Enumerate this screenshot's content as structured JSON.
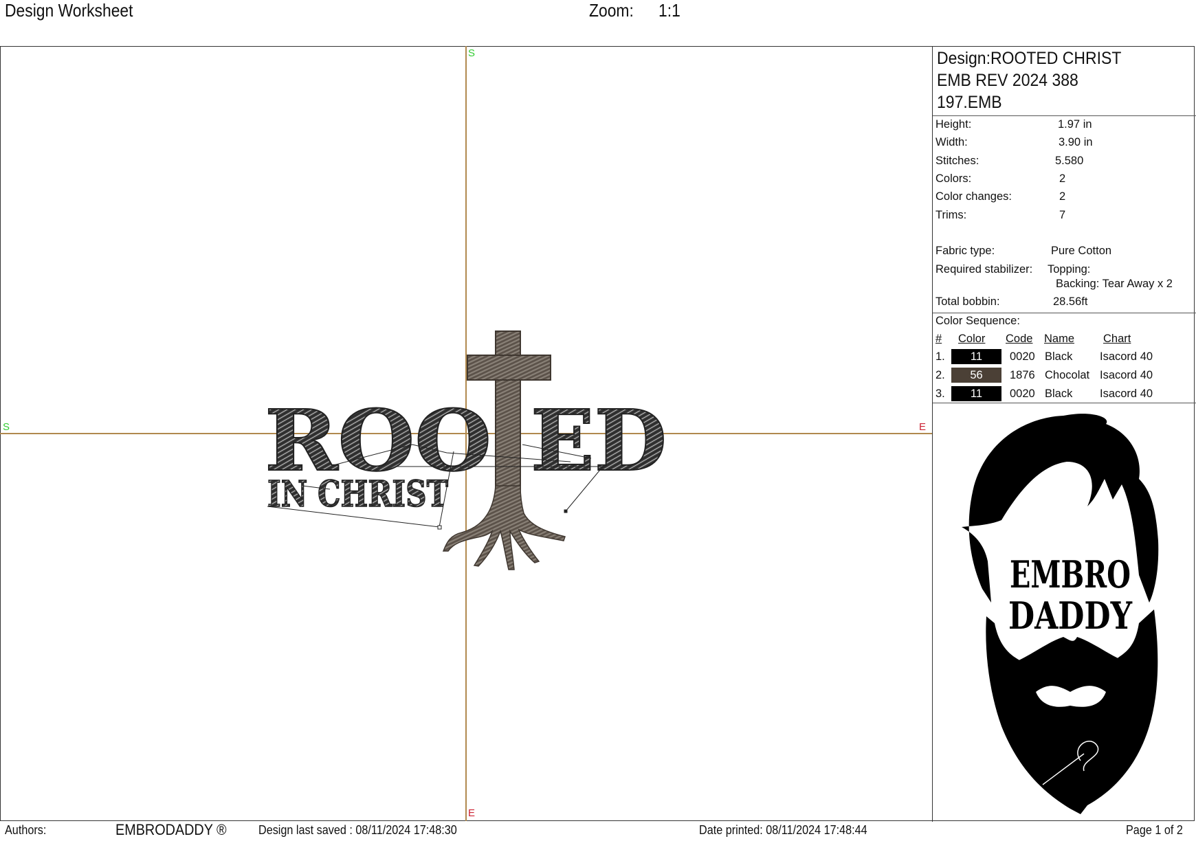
{
  "header": {
    "title": "Design Worksheet",
    "zoom_label": "Zoom:",
    "zoom_value": "1:1"
  },
  "canvas": {
    "axis_markers": {
      "top": "S",
      "left": "S",
      "right": "E",
      "bottom": "E"
    },
    "design_text": {
      "main": "ROOTED",
      "sub": "IN CHRIST"
    },
    "colors": {
      "black_thread": "#2a2a2a",
      "chocolate_thread": "#5a5048",
      "axis": "#b0894e",
      "start_marker": "#33cc33",
      "end_marker": "#cc2233"
    }
  },
  "panel": {
    "design_title_lines": [
      "Design:ROOTED CHRIST",
      "EMB REV 2024 388",
      "197.EMB"
    ],
    "specs": [
      {
        "label": "Height:",
        "value": "1.97 in"
      },
      {
        "label": "Width:",
        "value": "3.90 in"
      },
      {
        "label": "Stitches:",
        "value": "5.580"
      },
      {
        "label": "Colors:",
        "value": "2"
      },
      {
        "label": "Color changes:",
        "value": "2"
      },
      {
        "label": "Trims:",
        "value": "7"
      }
    ],
    "fabric": {
      "label": "Fabric type:",
      "value": "Pure Cotton"
    },
    "stabilizer": {
      "label": "Required stabilizer:",
      "topping": "Topping:",
      "backing": "Backing: Tear Away x 2"
    },
    "bobbin": {
      "label": "Total bobbin:",
      "value": "28.56ft"
    },
    "color_sequence": {
      "title": "Color Sequence:",
      "headers": {
        "num": "#",
        "color": "Color",
        "code": "Code",
        "name": "Name",
        "chart": "Chart"
      },
      "rows": [
        {
          "num": "1.",
          "swatch": "11",
          "hex": "#000000",
          "code": "0020",
          "name": "Black",
          "chart": "Isacord 40"
        },
        {
          "num": "2.",
          "swatch": "56",
          "hex": "#4b4036",
          "code": "1876",
          "name": "Chocolat",
          "chart": "Isacord 40"
        },
        {
          "num": "3.",
          "swatch": "11",
          "hex": "#000000",
          "code": "0020",
          "name": "Black",
          "chart": "Isacord 40"
        }
      ]
    },
    "logo": {
      "line1": "EMBRO",
      "line2": "DADDY"
    }
  },
  "footer": {
    "authors_label": "Authors:",
    "authors_value": "EMBRODADDY ®",
    "last_saved": "Design last saved : 08/11/2024 17:48:30",
    "date_printed": "Date printed: 08/11/2024 17:48:44",
    "page": "Page 1 of 2"
  }
}
